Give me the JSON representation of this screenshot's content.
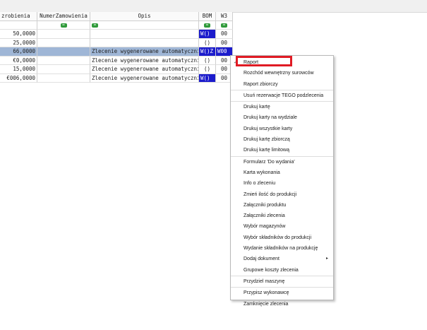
{
  "columns": [
    "zrobienia",
    "NumerZamowienia",
    "Opis",
    "BOM",
    "W3"
  ],
  "filter_icon": "filter-icon",
  "rows": [
    {
      "ilosc": "50,0000",
      "numer": "",
      "opis": "",
      "bom": "W()",
      "w3": "00"
    },
    {
      "ilosc": "25,0000",
      "numer": "",
      "opis": "",
      "bom": "()",
      "w3": "00"
    },
    {
      "ilosc": "66,0000",
      "numer": "",
      "opis": "Zlecenie wygenerowane automatycznie",
      "bom": "W()Z",
      "w3": "W00"
    },
    {
      "ilosc": "€0,0000",
      "numer": "",
      "opis": "Zlecenie wygenerowane automatycznie",
      "bom": "()",
      "w3": "00"
    },
    {
      "ilosc": "15,0000",
      "numer": "",
      "opis": "Zlecenie wygenerowane automatycznie",
      "bom": "()",
      "w3": "00"
    },
    {
      "ilosc": "€006,0000",
      "numer": "",
      "opis": "Zlecenie wygenerowane automatycznie",
      "bom": "W()",
      "w3": "00"
    }
  ],
  "context_menu": {
    "items": [
      {
        "label": "Raport",
        "icon": "check-icon"
      },
      {
        "label": "Rozchód wewnętrzny surowców"
      },
      {
        "label": "Raport zbiorczy"
      },
      {
        "label": "Usuń rezerwacje TEGO podzlecenia"
      },
      {
        "label": "Drukuj kartę"
      },
      {
        "label": "Drukuj karty na wydziale"
      },
      {
        "label": "Drukuj wszystkie karty"
      },
      {
        "label": "Drukuj kartę zbiorczą"
      },
      {
        "label": "Drukuj kartę limitową"
      },
      {
        "label": "Formularz 'Do wydania'"
      },
      {
        "label": "Karta wykonania"
      },
      {
        "label": "Info o zleceniu"
      },
      {
        "label": "Zmień ilość do produkcji"
      },
      {
        "label": "Załączniki produktu"
      },
      {
        "label": "Załączniki zlecenia"
      },
      {
        "label": "Wybór magazynów"
      },
      {
        "label": "Wybór składników do produkcji"
      },
      {
        "label": "Wydanie składników na produkcję"
      },
      {
        "label": "Dodaj dokument",
        "submenu": "▸"
      },
      {
        "label": "Grupowe koszty zlecenia"
      },
      {
        "label": "Przydziel maszynę"
      },
      {
        "label": "Przypisz wykonawcę"
      },
      {
        "label": "Zamknięcie zlecenia"
      }
    ]
  },
  "colors": {
    "selected_row": "#9fb6d6",
    "bom_highlight": "#1c1ccc",
    "highlight_box": "#e01b24",
    "filter_badge": "#2f9a3a"
  }
}
